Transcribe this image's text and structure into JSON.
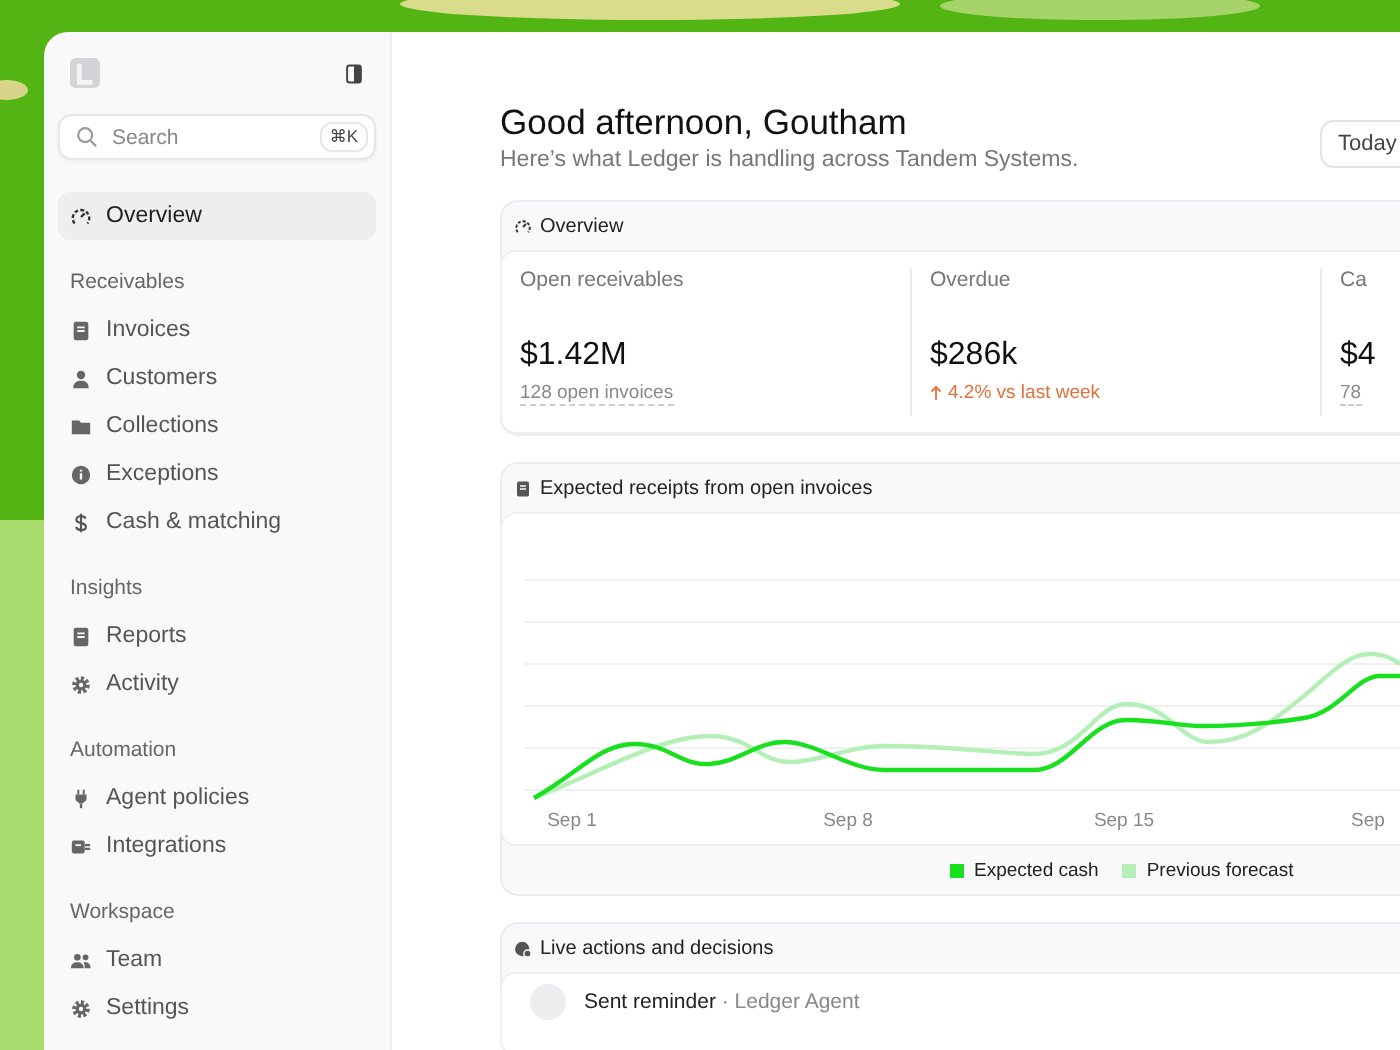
{
  "sidebar": {
    "search": {
      "placeholder": "Search",
      "shortcut": "⌘K"
    },
    "top_item": {
      "label": "Overview",
      "selected": true
    },
    "sections": [
      {
        "title": "Receivables",
        "items": [
          {
            "label": "Invoices",
            "selected": false
          },
          {
            "label": "Customers",
            "selected": false
          },
          {
            "label": "Collections",
            "selected": false
          },
          {
            "label": "Exceptions",
            "selected": false
          },
          {
            "label": "Cash & matching",
            "selected": false
          }
        ]
      },
      {
        "title": "Insights",
        "items": [
          {
            "label": "Reports",
            "selected": false
          },
          {
            "label": "Activity",
            "selected": false
          }
        ]
      },
      {
        "title": "Automation",
        "items": [
          {
            "label": "Agent policies",
            "selected": false
          },
          {
            "label": "Integrations",
            "selected": false
          }
        ]
      },
      {
        "title": "Workspace",
        "items": [
          {
            "label": "Team",
            "selected": false
          },
          {
            "label": "Settings",
            "selected": false
          }
        ]
      }
    ]
  },
  "header": {
    "title": "Good afternoon, Goutham",
    "subtitle": "Here’s what Ledger is handling across Tandem Systems.",
    "date_button": "Today"
  },
  "overview": {
    "title": "Overview",
    "metrics": [
      {
        "label": "Open receivables",
        "value": "$1.42M",
        "note": "128 open invoices",
        "rising": false
      },
      {
        "label": "Overdue",
        "value": "$286k",
        "note": "4.2% vs last week",
        "rising": true
      },
      {
        "label": "Ca",
        "value": "$4",
        "note": "78",
        "rising": false
      }
    ]
  },
  "receipts": {
    "title": "Expected receipts from open invoices",
    "x_labels": [
      "Sep 1",
      "Sep 8",
      "Sep 15",
      "Sep"
    ],
    "legend": [
      {
        "name": "Expected cash",
        "color": "#19e01f"
      },
      {
        "name": "Previous forecast",
        "color": "#b4efb8"
      }
    ]
  },
  "live": {
    "title": "Live actions and decisions",
    "entries": [
      {
        "action": "Sent reminder",
        "separator": "·",
        "actor": "Ledger Agent"
      }
    ]
  }
}
